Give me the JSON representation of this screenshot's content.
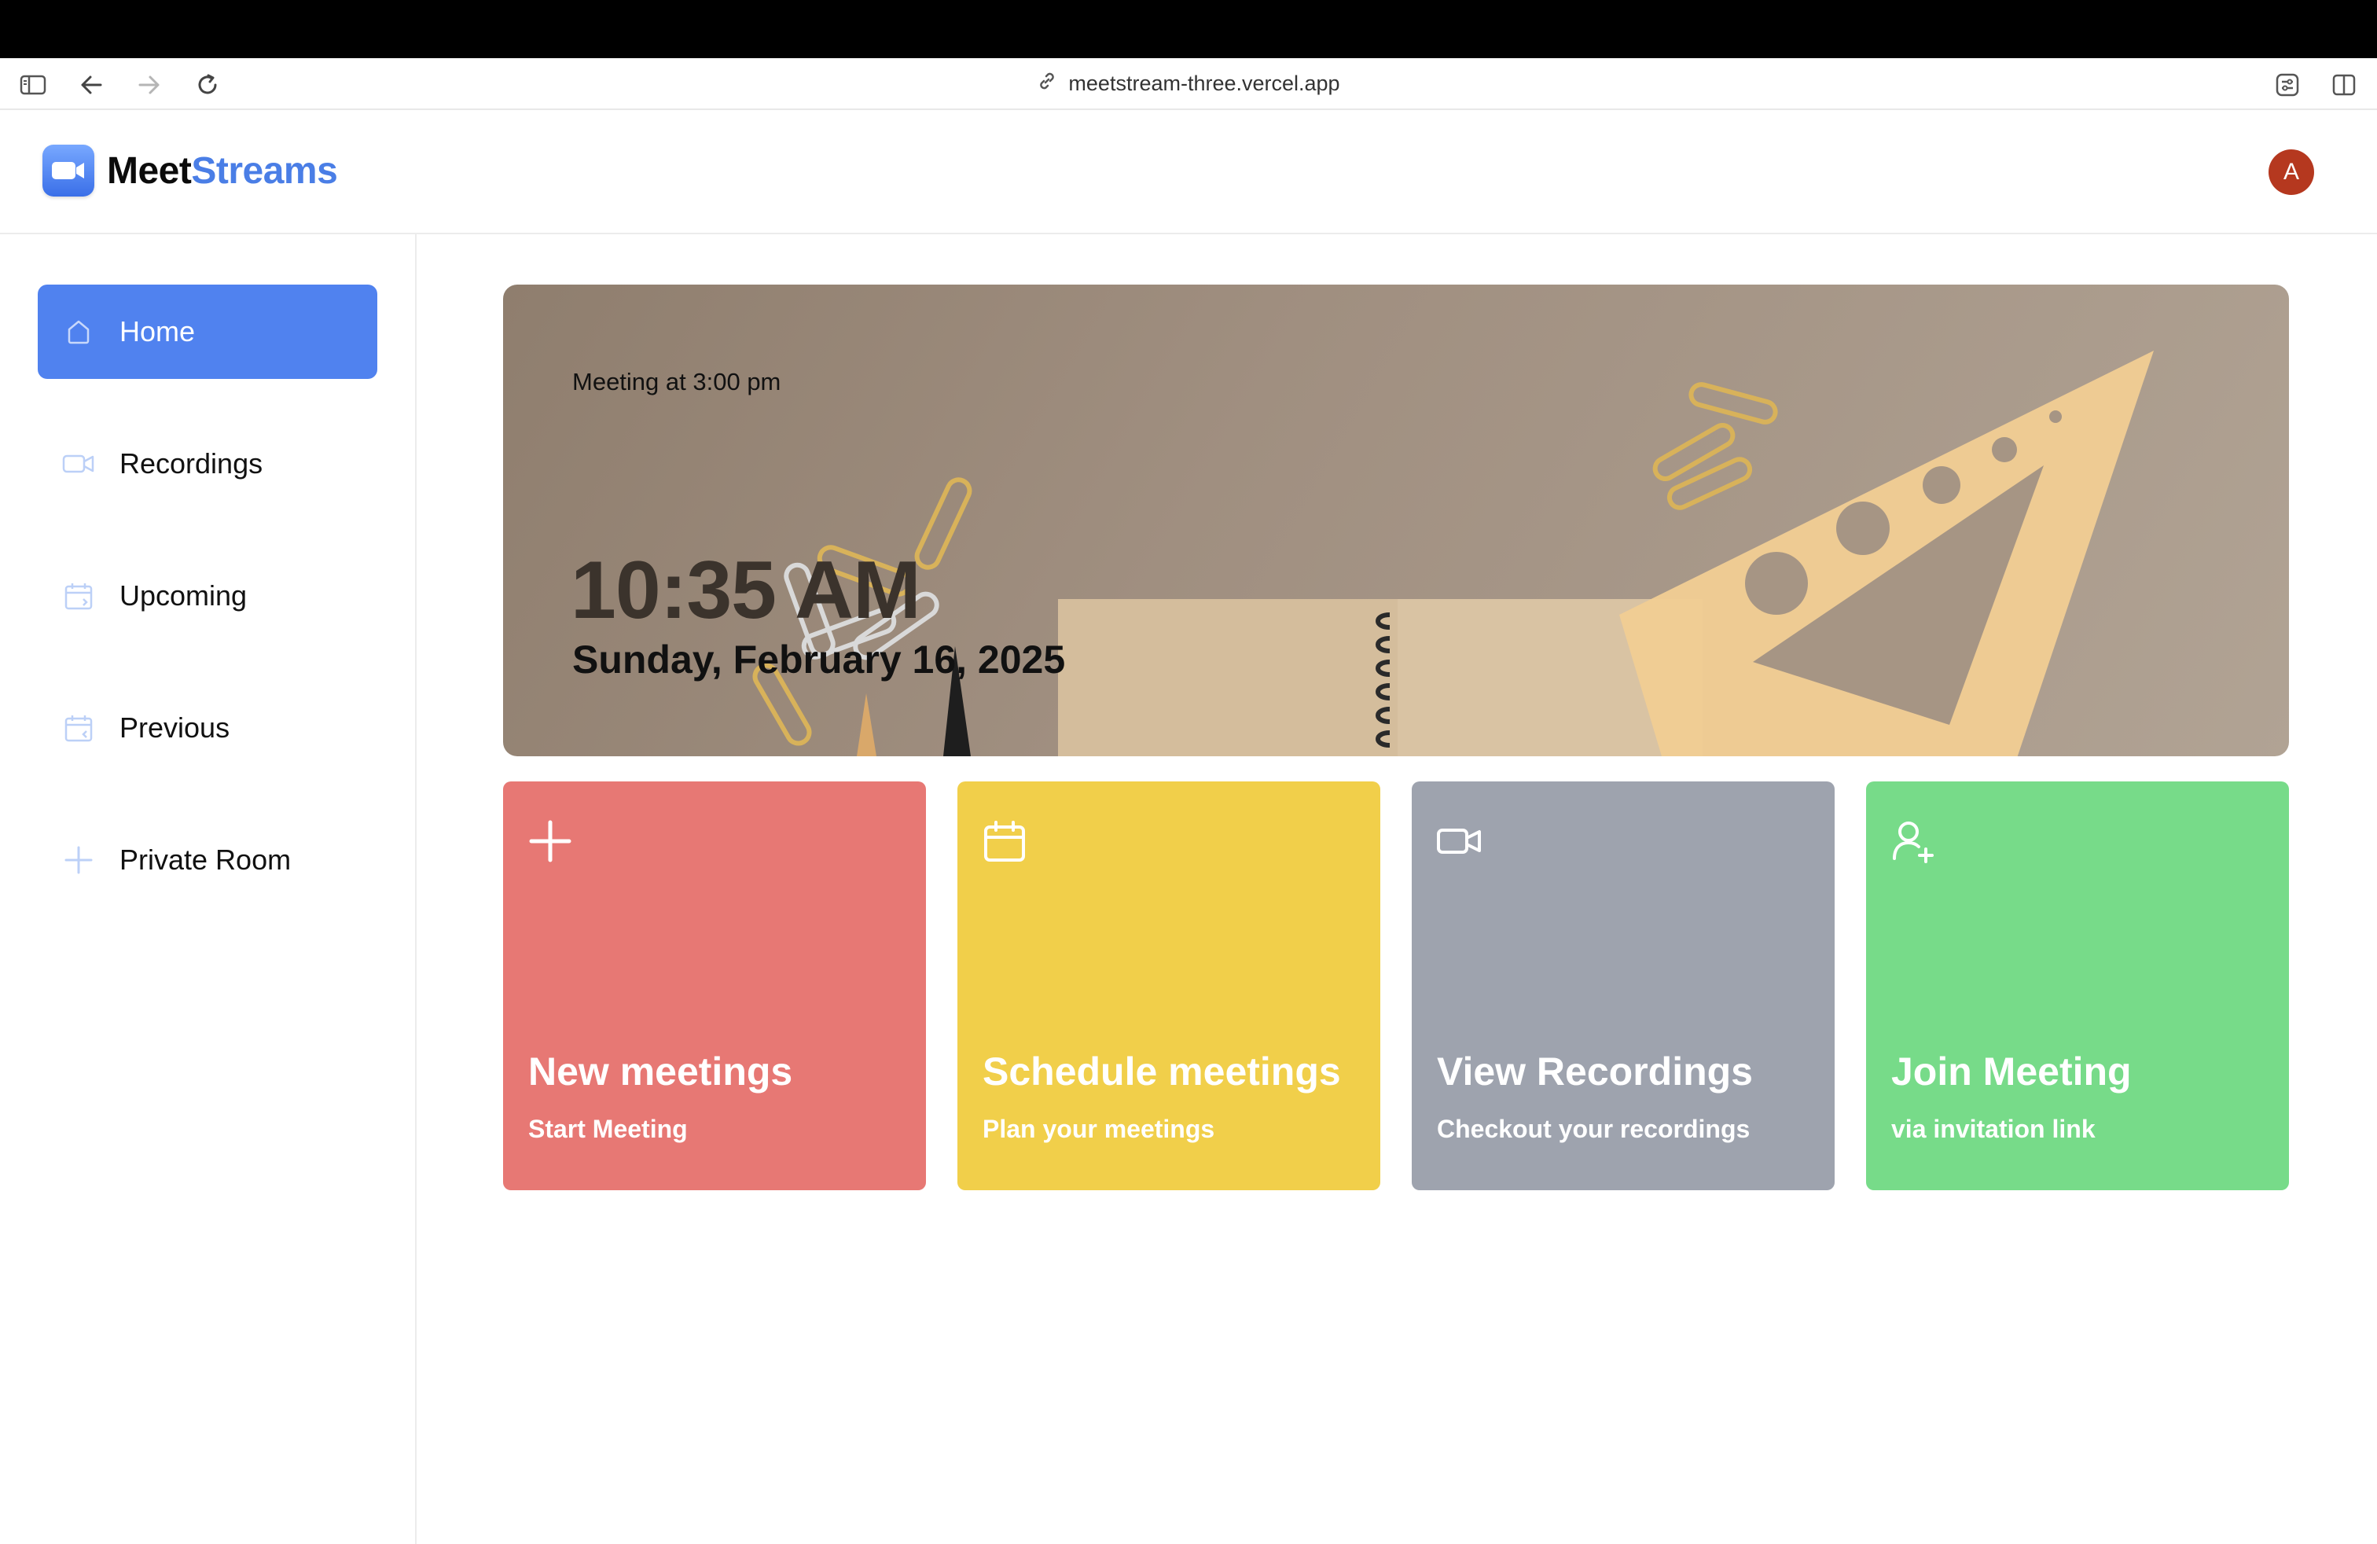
{
  "browser": {
    "url": "meetstream-three.vercel.app",
    "icons": [
      "sidebar-toggle-icon",
      "back-arrow-icon",
      "forward-arrow-icon",
      "reload-icon",
      "link-icon",
      "extensions-icon",
      "split-view-icon"
    ]
  },
  "app": {
    "brand_part1": "Meet",
    "brand_part2": "Streams",
    "brand_color": "#4a7ee6",
    "avatar_initial": "A",
    "avatar_color": "#b5381f"
  },
  "sidebar": {
    "accent": "#5082ef",
    "items": [
      {
        "label": "Home",
        "icon": "home-icon",
        "active": true
      },
      {
        "label": "Recordings",
        "icon": "video-icon",
        "active": false
      },
      {
        "label": "Upcoming",
        "icon": "calendar-forward-icon",
        "active": false
      },
      {
        "label": "Previous",
        "icon": "calendar-back-icon",
        "active": false
      },
      {
        "label": "Private Room",
        "icon": "plus-icon",
        "active": false
      }
    ]
  },
  "hero": {
    "meeting_text": "Meeting at 3:00 pm",
    "time": "10:35 AM",
    "date": "Sunday, February 16, 2025"
  },
  "cards": [
    {
      "title": "New meetings",
      "subtitle": "Start Meeting",
      "icon": "plus-icon",
      "color": "#e77874"
    },
    {
      "title": "Schedule meetings",
      "subtitle": "Plan your meetings",
      "icon": "calendar-icon",
      "color": "#f1cf4a"
    },
    {
      "title": "View Recordings",
      "subtitle": "Checkout your recordings",
      "icon": "video-icon",
      "color": "#9ea3ae"
    },
    {
      "title": "Join Meeting",
      "subtitle": "via invitation link",
      "icon": "user-plus-icon",
      "color": "#77db89"
    }
  ]
}
